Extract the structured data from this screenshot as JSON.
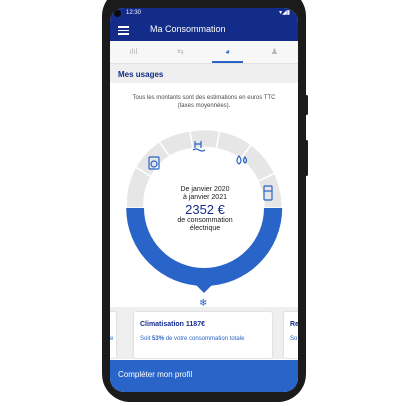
{
  "status_bar": {
    "time": "12:30",
    "icons": "▾◢▮"
  },
  "app_bar": {
    "title": "Ma Consommation"
  },
  "tabs": [
    {
      "icon": "bar-chart-icon",
      "glyph": "ılıl"
    },
    {
      "icon": "swap-arrows-icon",
      "glyph": "⇆"
    },
    {
      "icon": "usage-pie-icon",
      "glyph": "◕"
    },
    {
      "icon": "person-icon",
      "glyph": "♟"
    }
  ],
  "section": {
    "title": "Mes usages"
  },
  "note": "Tous les montants sont des estimations en euros TTC (taxes moyennées).",
  "donut": {
    "period_line1": "De janvier 2020",
    "period_line2": "à janvier 2021",
    "amount": "2352 €",
    "label_line1": "de consommation",
    "label_line2": "électrique",
    "accent_color": "#2964c8",
    "segment_color": "#dcdcdc",
    "segment_icons": [
      "washing-machine-icon",
      "pool-icon",
      "water-heater-icon",
      "fridge-icon"
    ],
    "selected_icon": "snowflake-icon",
    "selected_glyph": "❄"
  },
  "cards": [
    {
      "title": "",
      "sub": "e"
    },
    {
      "title": "Climatisation 1187€",
      "sub_prefix": "Soit ",
      "sub_bold": "53%",
      "sub_suffix": " de votre consommation totale"
    },
    {
      "title": "Re",
      "sub": "So"
    }
  ],
  "bottom_bar": {
    "label": "Compléter mon profil"
  }
}
